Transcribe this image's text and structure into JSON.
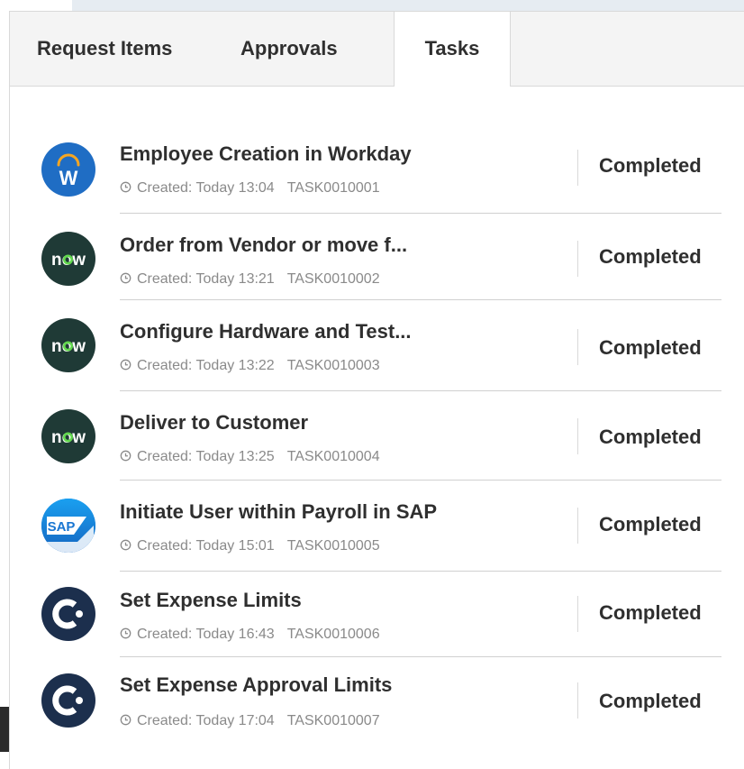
{
  "tabs": [
    {
      "label": "Request Items",
      "active": false
    },
    {
      "label": "Approvals",
      "active": false
    },
    {
      "label": "Tasks",
      "active": true
    }
  ],
  "colors": {
    "workday_blue": "#1f6dc4",
    "workday_orange": "#f5a623",
    "now_dark": "#1f3a36",
    "now_green": "#62d84e",
    "sap_blue": "#1e88e5",
    "concur_navy": "#1c2f4d"
  },
  "tasks": [
    {
      "icon": "workday-logo-icon",
      "title": "Employee Creation in Workday",
      "created": "Created: Today 13:04",
      "number": "TASK0010001",
      "status": "Completed"
    },
    {
      "icon": "servicenow-logo-icon",
      "title": "Order from Vendor or move f...",
      "created": "Created: Today 13:21",
      "number": "TASK0010002",
      "status": "Completed"
    },
    {
      "icon": "servicenow-logo-icon",
      "title": "Configure Hardware and Test...",
      "created": "Created: Today 13:22",
      "number": "TASK0010003",
      "status": "Completed"
    },
    {
      "icon": "servicenow-logo-icon",
      "title": "Deliver to Customer",
      "created": "Created: Today 13:25",
      "number": "TASK0010004",
      "status": "Completed"
    },
    {
      "icon": "sap-logo-icon",
      "title": "Initiate User within Payroll in SAP",
      "created": "Created: Today 15:01",
      "number": "TASK0010005",
      "status": "Completed"
    },
    {
      "icon": "concur-logo-icon",
      "title": "Set Expense Limits",
      "created": "Created: Today 16:43",
      "number": "TASK0010006",
      "status": "Completed"
    },
    {
      "icon": "concur-logo-icon",
      "title": "Set Expense Approval Limits",
      "created": "Created: Today 17:04",
      "number": "TASK0010007",
      "status": "Completed"
    }
  ],
  "logos": {
    "workday": "W",
    "now": "now",
    "sap": "SAP"
  }
}
